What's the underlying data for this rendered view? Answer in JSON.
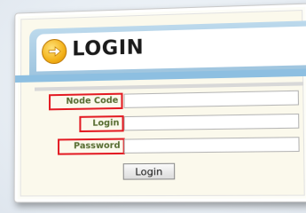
{
  "header": {
    "title": "LOGIN",
    "logo_icon": "arrow-right-circle-icon"
  },
  "form": {
    "node_code_label": "Node Code",
    "node_code_value": "",
    "login_label": "Login",
    "login_value": "",
    "password_label": "Password",
    "password_value": "",
    "submit_label": "Login"
  },
  "colors": {
    "highlight": "#e31b23",
    "label_text": "#556b2f",
    "header_band": "#9fc5df",
    "logo": "#f3b21a"
  }
}
